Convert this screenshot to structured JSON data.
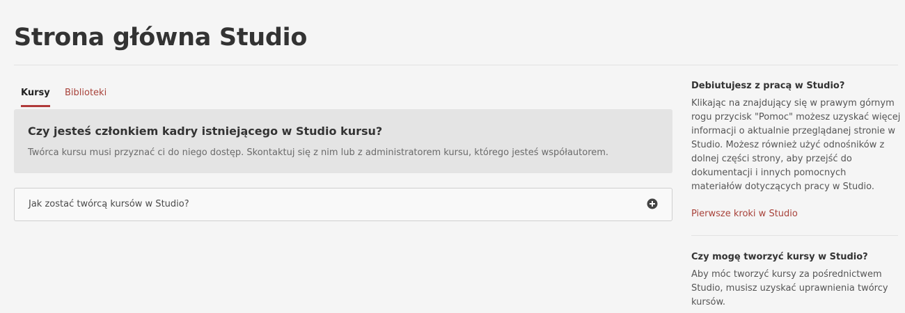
{
  "page": {
    "title": "Strona główna Studio"
  },
  "tabs": [
    {
      "label": "Kursy",
      "active": true
    },
    {
      "label": "Biblioteki",
      "active": false
    }
  ],
  "info_box": {
    "title": "Czy jesteś członkiem kadry istniejącego w Studio kursu?",
    "text": "Twórca kursu musi przyznać ci do niego dostęp. Skontaktuj się z nim lub z administratorem kursu, którego jesteś współautorem."
  },
  "accordion": {
    "label": "Jak zostać twórcą kursów w Studio?",
    "icon": "plus-circle-icon"
  },
  "sidebar": {
    "section1": {
      "heading": "Debiutujesz z pracą w Studio?",
      "lines": [
        "Klikając na znajdujący się w prawym górnym",
        "rogu przycisk \"Pomoc\" możesz uzyskać więcej",
        "informacji o aktualnie przeglądanej stronie w",
        "Studio. Możesz również użyć odnośników z",
        "dolnej części strony, aby przejść do",
        "dokumentacji i innych pomocnych",
        "materiałów dotyczących pracy w Studio."
      ],
      "link": "Pierwsze kroki w Studio"
    },
    "section2": {
      "heading": "Czy mogę tworzyć kursy w Studio?",
      "lines": [
        "Aby móc tworzyć kursy za pośrednictwem",
        "Studio, musisz uzyskać uprawnienia twórcy",
        "kursów."
      ]
    }
  },
  "colors": {
    "accent": "#b03a3a",
    "link": "#a8423a"
  }
}
